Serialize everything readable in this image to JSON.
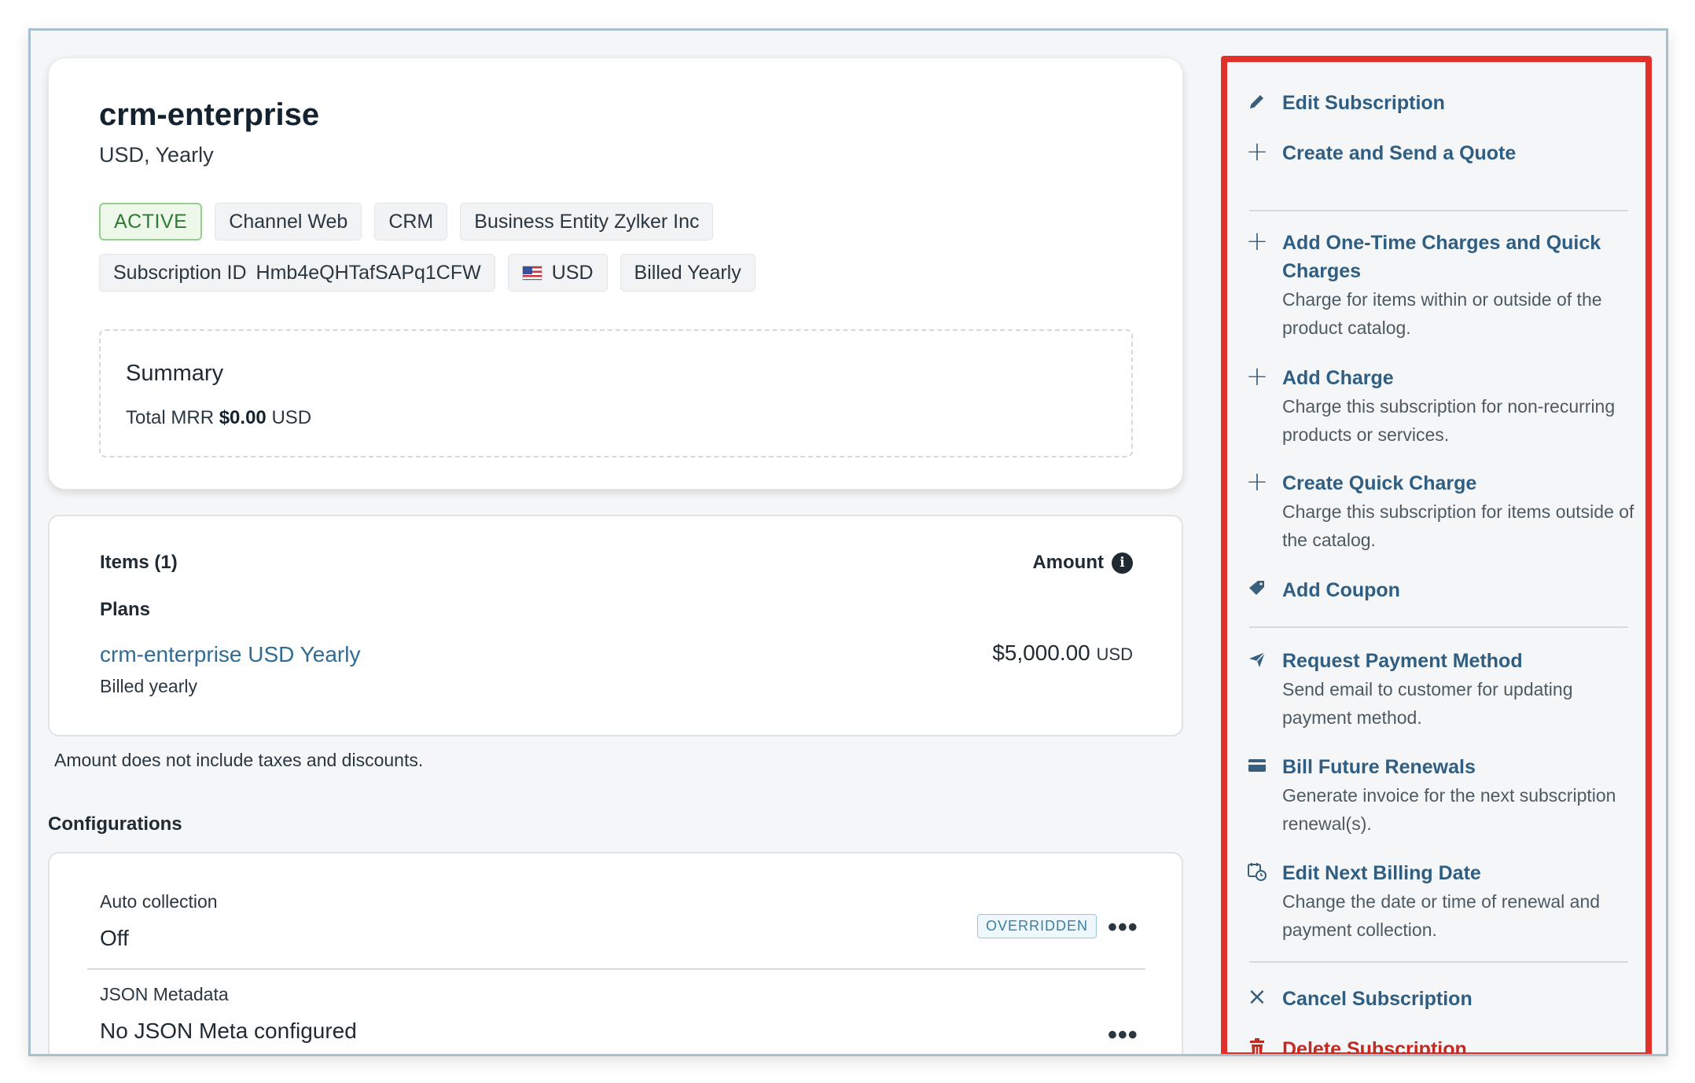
{
  "subscription": {
    "title": "crm-enterprise",
    "subtitle": "USD, Yearly",
    "tags_row1": [
      {
        "label": "ACTIVE"
      },
      {
        "label": "Channel Web"
      },
      {
        "label": "CRM"
      },
      {
        "label": "Business Entity Zylker Inc"
      }
    ],
    "tags_row2": {
      "subscription_id_label": "Subscription ID",
      "subscription_id_value": "Hmb4eQHTafSAPq1CFW",
      "currency": "USD",
      "billing": "Billed Yearly"
    },
    "summary": {
      "title": "Summary",
      "mrr_label": "Total MRR",
      "mrr_value": "$0.00",
      "mrr_currency": "USD"
    }
  },
  "items": {
    "title": "Items (1)",
    "amount_header": "Amount",
    "plans_label": "Plans",
    "plan": {
      "name": "crm-enterprise USD Yearly",
      "billing": "Billed yearly",
      "amount": "$5,000.00",
      "currency": "USD"
    },
    "note": "Amount does not include taxes and discounts."
  },
  "configurations": {
    "title": "Configurations",
    "auto_collection_label": "Auto collection",
    "auto_collection_value": "Off",
    "overridden_badge": "OVERRIDDEN",
    "json_metadata_label": "JSON Metadata",
    "json_metadata_value": "No JSON Meta configured",
    "more_label": "•••"
  },
  "menu": {
    "edit_subscription": "Edit Subscription",
    "create_quote": "Create and Send a Quote",
    "add_one_time": "Add One-Time Charges and Quick Charges",
    "add_one_time_desc": "Charge for items within or outside of the product catalog.",
    "add_charge": "Add Charge",
    "add_charge_desc": "Charge this subscription for non-recurring products or services.",
    "quick_charge": "Create Quick Charge",
    "quick_charge_desc": "Charge this subscription for items outside of the catalog.",
    "add_coupon": "Add Coupon",
    "request_payment": "Request Payment Method",
    "request_payment_desc": "Send email to customer for updating payment method.",
    "bill_future": "Bill Future Renewals",
    "bill_future_desc": "Generate invoice for the next subscription renewal(s).",
    "edit_billing_date": "Edit Next Billing Date",
    "edit_billing_date_desc": "Change the date or time of renewal and payment collection.",
    "cancel_subscription": "Cancel Subscription",
    "delete_subscription": "Delete Subscription"
  },
  "colors": {
    "accent_link": "#2f6b94",
    "menu_title": "#2f5e82",
    "danger": "#c22a22",
    "highlight_border": "#e0312a",
    "active_badge": "#2f7a33"
  },
  "icons": {
    "edit": "pencil-icon",
    "quote": "plus-icon",
    "coupon": "tag-icon",
    "request_payment": "paper-plane-icon",
    "bill_future": "card-icon",
    "billing_date": "calendar-clock-icon",
    "cancel": "close-icon",
    "delete": "trash-icon",
    "info": "info-icon"
  }
}
